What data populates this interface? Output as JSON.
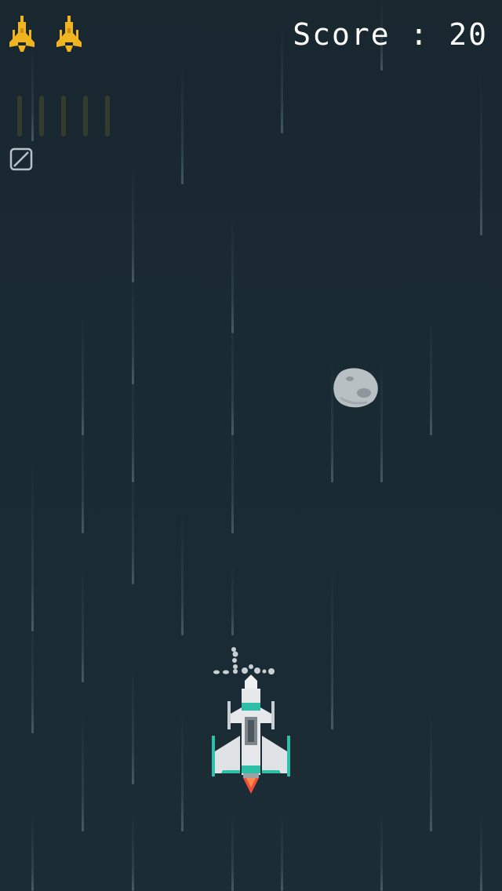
{
  "hud": {
    "score_text": "Score : 20",
    "lives_count": 2,
    "ammo_count": 5,
    "lives_icon": "ship-life-icon",
    "shield_icon": "shield-disabled-icon"
  },
  "colors": {
    "background": "#1b2a33",
    "life_icon": "#f0b421",
    "ship_body": "#e6e8ea",
    "ship_accent": "#2fbfa9",
    "ship_flame": "#f0503a",
    "asteroid": "#b9c0c4",
    "score_text": "#ffffff",
    "ammo_inactive": "#39402e"
  },
  "entities": {
    "player_ship": "player-ship",
    "asteroid": "asteroid",
    "debris": "debris"
  }
}
